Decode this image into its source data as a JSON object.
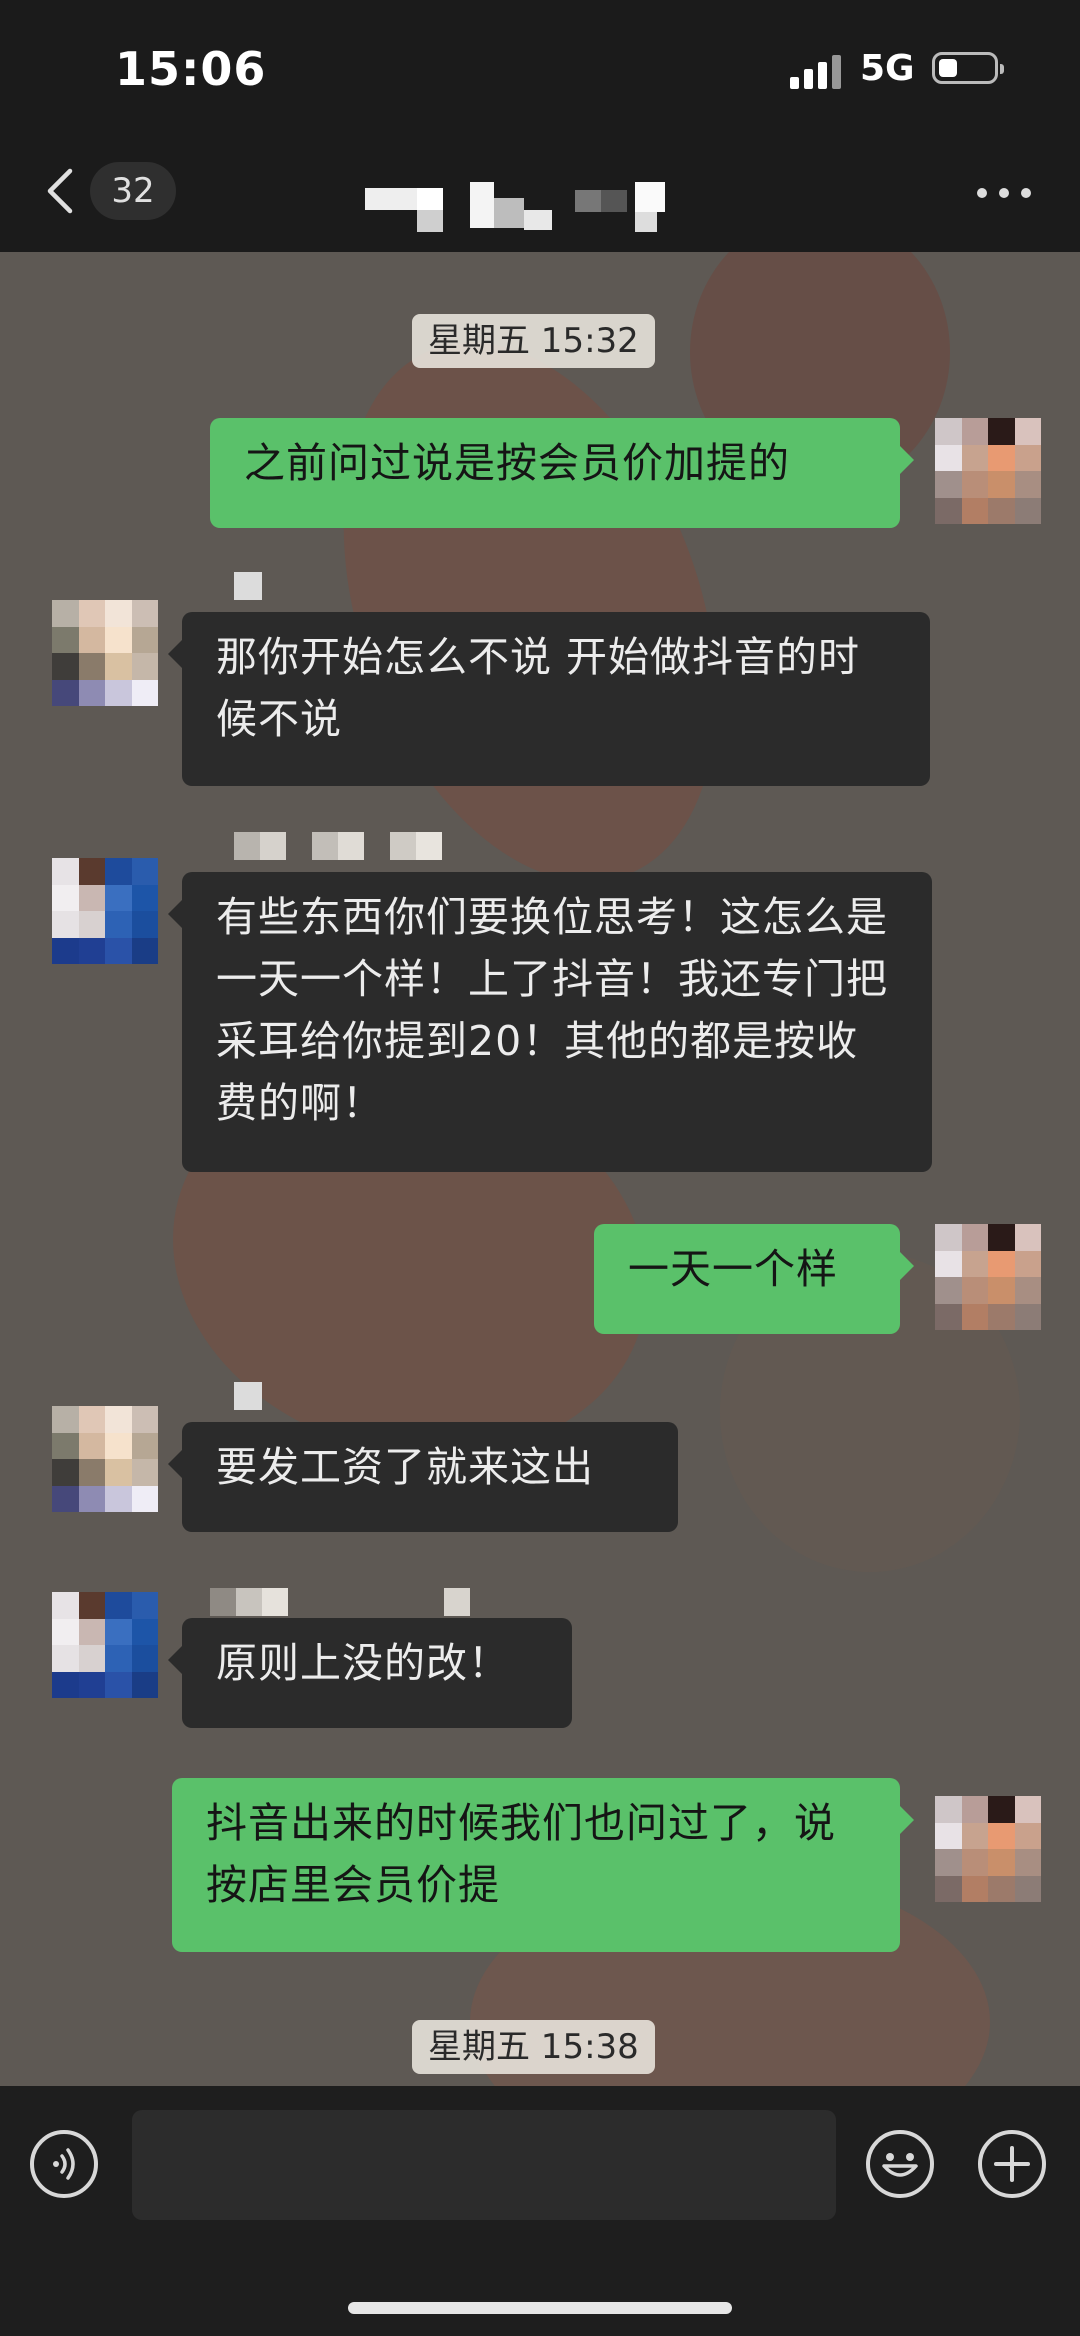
{
  "status_bar": {
    "time": "15:06",
    "network": "5G"
  },
  "nav": {
    "unread_count": "32",
    "back_icon": "chevron-left-icon",
    "more_icon": "more-dots-icon"
  },
  "timestamps": [
    {
      "text": "星期五 15:32"
    },
    {
      "text": "星期五 15:38"
    }
  ],
  "messages": [
    {
      "direction": "out",
      "text": "之前问过说是按会员价加提的"
    },
    {
      "direction": "in",
      "text": "那你开始怎么不说 开始做抖音的时候不说"
    },
    {
      "direction": "in",
      "text": "有些东西你们要换位思考！这怎么是一天一个样！上了抖音！我还专门把采耳给你提到20！其他的都是按收费的啊！"
    },
    {
      "direction": "out",
      "text": "一天一个样"
    },
    {
      "direction": "in",
      "text": "要发工资了就来这出"
    },
    {
      "direction": "in",
      "text": "原则上没的改！"
    },
    {
      "direction": "out",
      "text": "抖音出来的时候我们也问过了，说按店里会员价提"
    }
  ],
  "input_bar": {
    "voice_icon": "voice-icon",
    "emoji_icon": "emoji-icon",
    "add_icon": "plus-icon",
    "input_value": ""
  },
  "colors": {
    "outgoing_bubble": "#5ac16a",
    "incoming_bubble": "#2b2b2b",
    "chat_background": "#5e5954"
  }
}
